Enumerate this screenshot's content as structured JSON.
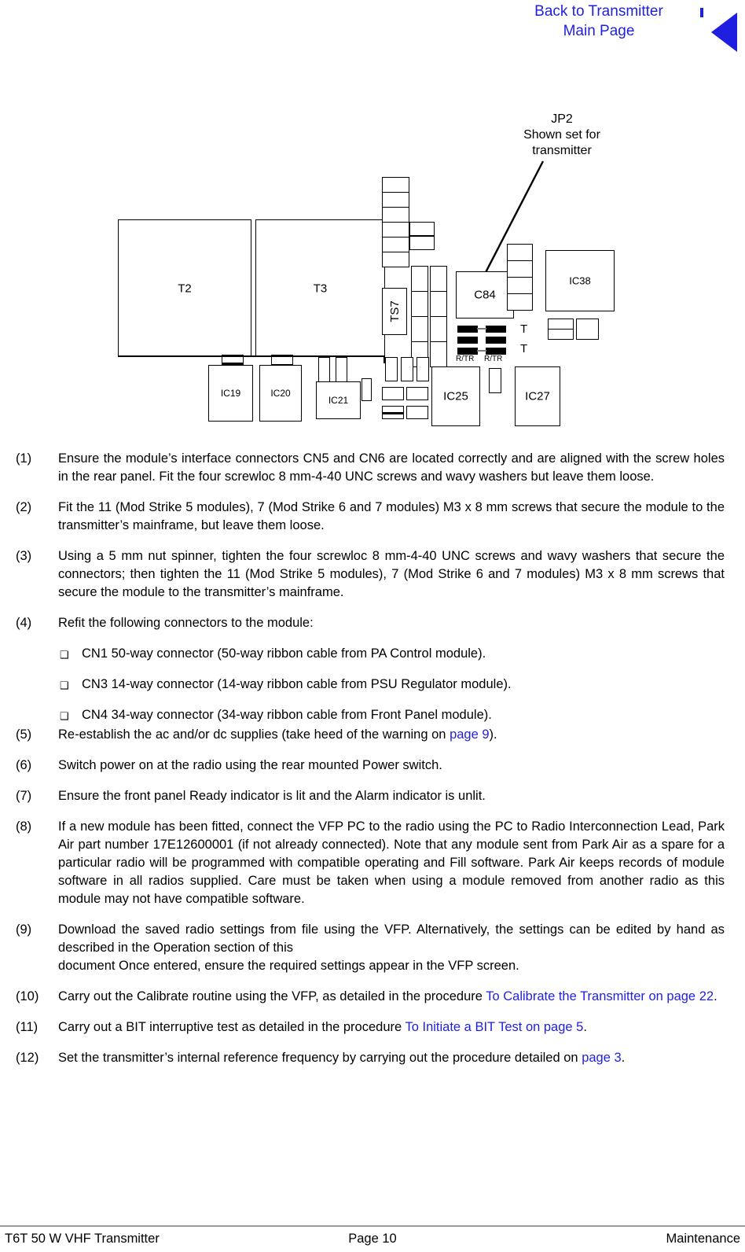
{
  "header": {
    "back_link_line1": "Back to Transmitter",
    "back_link_line2": "Main Page",
    "link_color": "#1f1fe0"
  },
  "diagram": {
    "callout": {
      "line1": "JP2",
      "line2": "Shown set for",
      "line3": "transmitter"
    },
    "components": [
      {
        "id": "T2",
        "label": "T2"
      },
      {
        "id": "T3",
        "label": "T3"
      },
      {
        "id": "TS7",
        "label": "TS7"
      },
      {
        "id": "C84",
        "label": "C84"
      },
      {
        "id": "IC38",
        "label": "IC38"
      },
      {
        "id": "IC19",
        "label": "IC19"
      },
      {
        "id": "IC20",
        "label": "IC20"
      },
      {
        "id": "IC21",
        "label": "IC21"
      },
      {
        "id": "IC25",
        "label": "IC25"
      },
      {
        "id": "IC27",
        "label": "IC27"
      }
    ],
    "jumper": {
      "left_label": "R/TR",
      "right_label": "R/TR",
      "t_label_top": "T",
      "t_label_bottom": "T"
    }
  },
  "steps": [
    {
      "num": "(1)",
      "text": "Ensure the module’s interface connectors CN5 and CN6 are located correctly and are aligned with the screw holes in the rear panel. Fit the four screwloc 8 mm-4-40 UNC screws and wavy washers but leave them loose."
    },
    {
      "num": "(2)",
      "text": "Fit the 11 (Mod Strike 5 modules), 7 (Mod Strike 6 and 7 modules) M3 x 8 mm screws that secure the module to the transmitter’s mainframe, but leave them loose."
    },
    {
      "num": "(3)",
      "text": "Using a 5 mm nut spinner, tighten the four screwloc 8 mm-4-40 UNC screws and wavy washers that secure the connectors; then tighten the 11 (Mod Strike 5 modules), 7 (Mod Strike 6 and 7 modules) M3 x 8 mm screws that secure the module to the transmitter’s mainframe."
    },
    {
      "num": "(4)",
      "text": "Refit the following connectors to the module:"
    }
  ],
  "bullets": [
    {
      "mark": "❑",
      "text": "CN1 50-way connector (50-way ribbon cable from PA Control module)."
    },
    {
      "mark": "❑",
      "text": "CN3 14-way connector (14-way ribbon cable from PSU Regulator module)."
    },
    {
      "mark": "❑",
      "text": "CN4 34-way connector (34-way ribbon cable from Front Panel module)."
    }
  ],
  "steps2": {
    "s5": {
      "num": "(5)",
      "pre": "Re-establish the ac and/or dc supplies (take heed of the warning on ",
      "link": "page 9",
      "post": ")."
    },
    "s6": {
      "num": "(6)",
      "text": "Switch power on at the radio using the rear mounted Power switch."
    },
    "s7": {
      "num": "(7)",
      "text": "Ensure the front panel Ready indicator is lit and the Alarm indicator is unlit."
    },
    "s8": {
      "num": "(8)",
      "text": "If a new module has been fitted, connect the VFP PC to the radio using the PC to Radio Interconnection Lead, Park Air part number 17E12600001 (if not already connected). Note that any module sent from Park Air as a spare for a particular radio will be programmed with compatible operating and Fill software. Park Air keeps records of module software in all radios supplied. Care must be taken when using a module removed from another radio as this module may not have compatible software."
    },
    "s9": {
      "num": "(9)",
      "line1": "Download the saved radio settings from file using the VFP. Alternatively, the settings can be edited by hand as described in the Operation section of this",
      "line2": "document Once entered, ensure the required settings appear in the VFP screen."
    },
    "s10": {
      "num": "(10)",
      "pre": "Carry out the Calibrate routine using the VFP, as detailed in the procedure ",
      "link": "To Calibrate the Transmitter on page 22",
      "post": "."
    },
    "s11": {
      "num": "(11)",
      "pre": "Carry out a BIT interruptive test as detailed in the procedure ",
      "link": "To Initiate a BIT Test on page 5",
      "post": "."
    },
    "s12": {
      "num": "(12)",
      "pre": "Set the transmitter’s internal reference frequency by carrying out the procedure detailed on ",
      "link": "page 3",
      "post": "."
    }
  },
  "footer": {
    "left": "T6T 50 W VHF Transmitter",
    "center": "Page 10",
    "right": "Maintenance"
  }
}
